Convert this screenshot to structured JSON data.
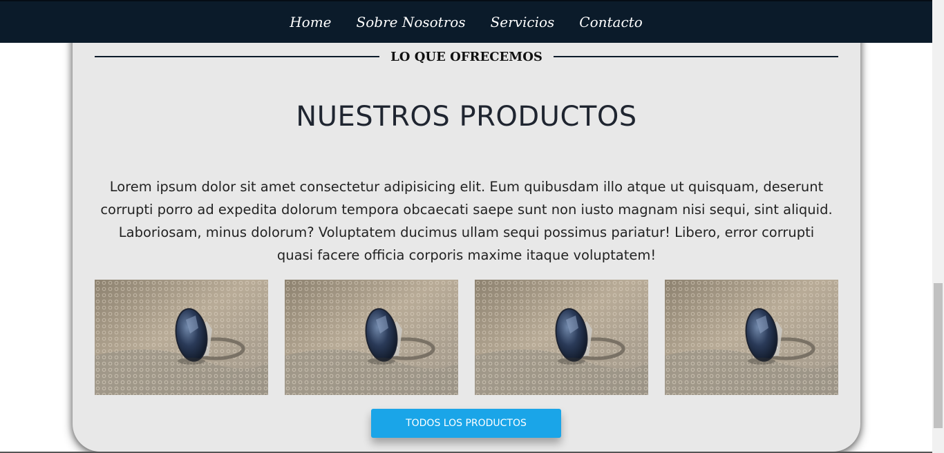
{
  "nav": {
    "items": [
      {
        "label": "Home"
      },
      {
        "label": "Sobre Nosotros"
      },
      {
        "label": "Servicios"
      },
      {
        "label": "Contacto"
      }
    ]
  },
  "section": {
    "label": "LO QUE OFRECEMOS",
    "title": "NUESTROS PRODUCTOS",
    "description": "Lorem ipsum dolor sit amet consectetur adipisicing elit. Eum quibusdam illo atque ut quisquam, deserunt corrupti porro ad expedita dolorum tempora obcaecati saepe sunt non iusto magnam nisi sequi, sint aliquid. Laboriosam, minus dolorum? Voluptatem ducimus ullam sequi possimus pariatur! Libero, error corrupti quasi facere officia corporis maxime itaque voluptatem!"
  },
  "products": [
    {
      "image": "ring-photo"
    },
    {
      "image": "ring-photo"
    },
    {
      "image": "ring-photo"
    },
    {
      "image": "ring-photo"
    }
  ],
  "cta": {
    "label": "TODOS LOS PRODUCTOS"
  },
  "colors": {
    "navbar": "#0b1b2a",
    "card": "#e8e8e8",
    "accent": "#1aa5e8"
  }
}
